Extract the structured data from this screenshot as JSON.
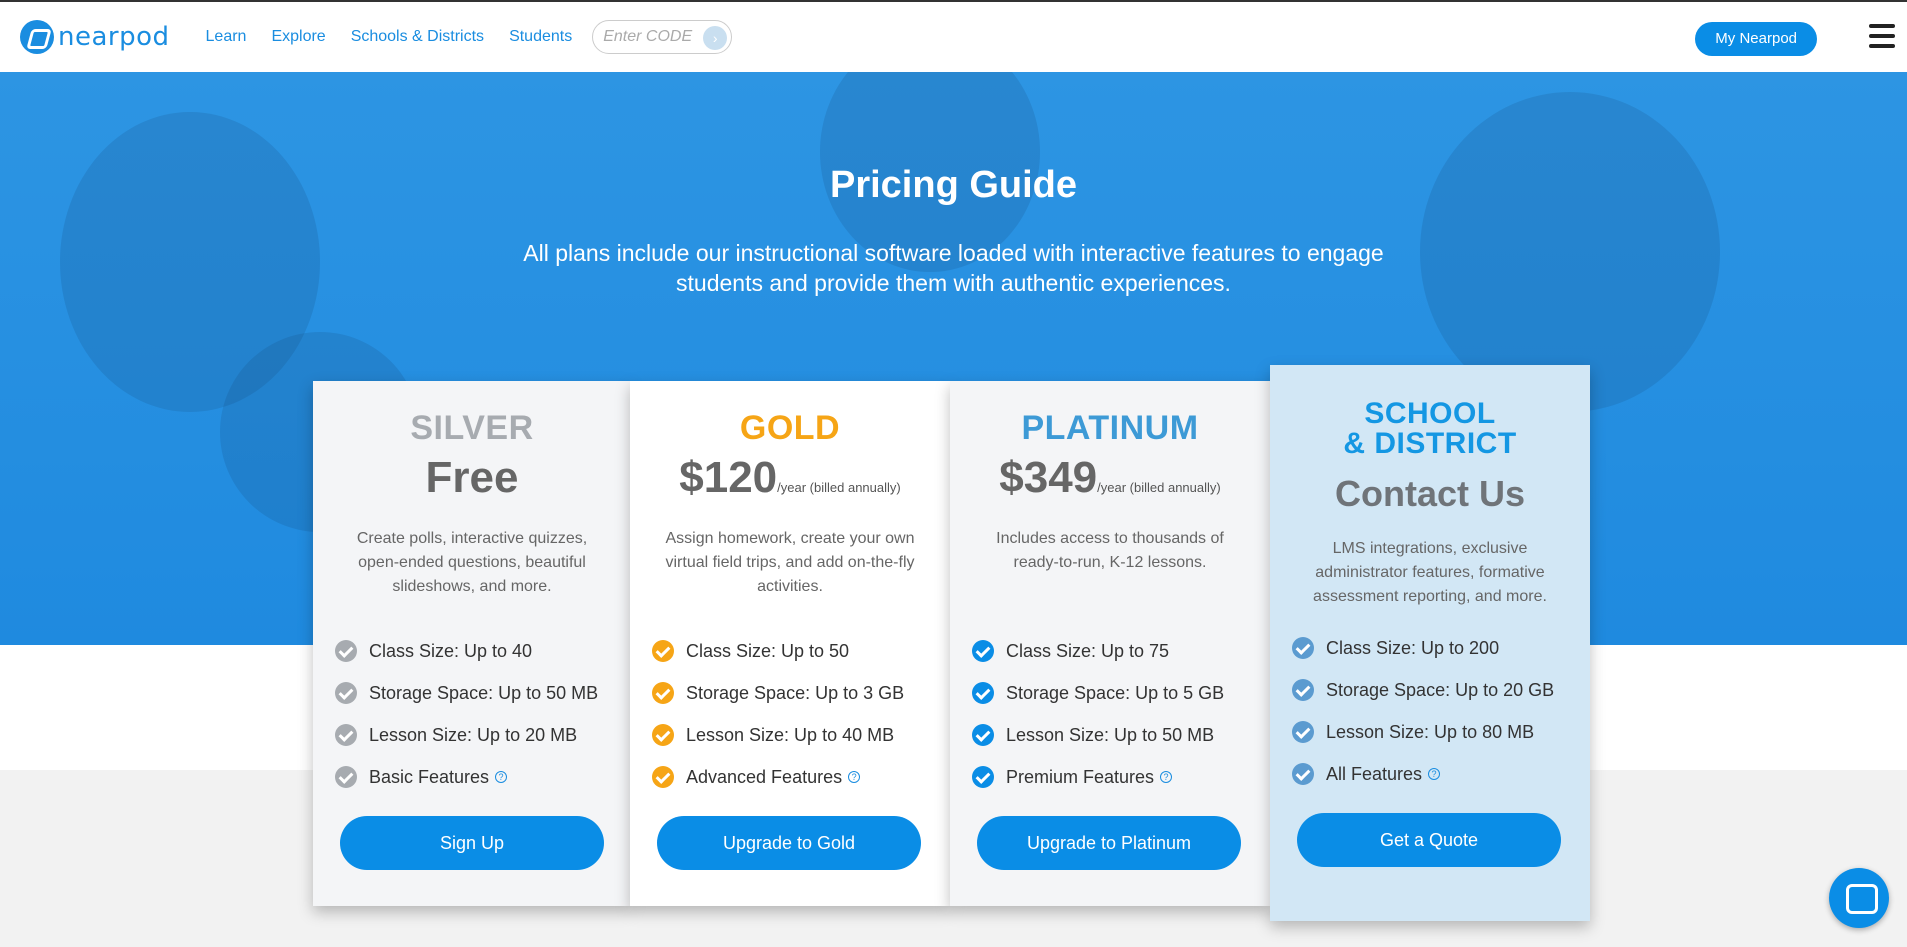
{
  "brand": {
    "name": "nearpod"
  },
  "nav": {
    "items": [
      "Learn",
      "Explore",
      "Schools & Districts",
      "Students"
    ],
    "code_placeholder": "Enter CODE",
    "my_button": "My Nearpod"
  },
  "hero": {
    "title": "Pricing Guide",
    "subtitle": "All plans include our instructional software loaded with interactive features to engage students and provide them with authentic experiences."
  },
  "colors": {
    "primary": "#0a8de6",
    "silver": "#a7abb0",
    "gold": "#f6a516",
    "platinum": "#3d9ad6",
    "school": "#1497e3"
  },
  "plans": [
    {
      "tier": "SILVER",
      "price": "Free",
      "price_note": "",
      "description": "Create polls, interactive quizzes, open-ended questions, beautiful slideshows, and more.",
      "features": [
        "Class Size: Up to 40",
        "Storage Space: Up to 50 MB",
        "Lesson Size: Up to 20 MB",
        "Basic Features"
      ],
      "cta": "Sign Up"
    },
    {
      "tier": "GOLD",
      "price": "$120",
      "price_note": "/year (billed annually)",
      "description": "Assign homework, create your own virtual field trips, and add on-the-fly activities.",
      "features": [
        "Class Size: Up to 50",
        "Storage Space: Up to 3 GB",
        "Lesson Size: Up to 40 MB",
        "Advanced Features"
      ],
      "cta": "Upgrade to Gold"
    },
    {
      "tier": "PLATINUM",
      "price": "$349",
      "price_note": "/year (billed annually)",
      "description": "Includes access to thousands of ready-to-run, K-12 lessons.",
      "features": [
        "Class Size: Up to 75",
        "Storage Space: Up to 5 GB",
        "Lesson Size: Up to 50 MB",
        "Premium Features"
      ],
      "cta": "Upgrade to Platinum"
    },
    {
      "tier_line1": "SCHOOL",
      "tier_line2": "& DISTRICT",
      "price": "Contact Us",
      "description": "LMS integrations, exclusive administrator features, formative assessment reporting, and more.",
      "features": [
        "Class Size: Up to 200",
        "Storage Space: Up to 20 GB",
        "Lesson Size: Up to 80 MB",
        "All Features"
      ],
      "cta": "Get a Quote"
    }
  ]
}
